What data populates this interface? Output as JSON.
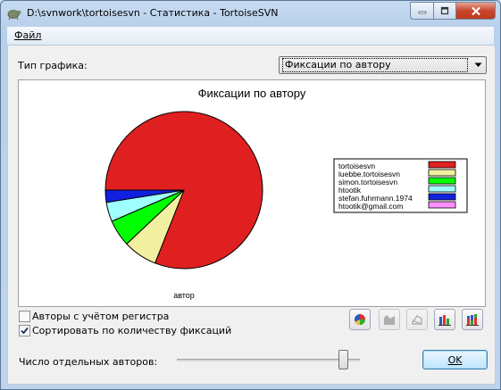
{
  "window": {
    "title": "D:\\svnwork\\tortoisesvn - Статистика - TortoiseSVN"
  },
  "menu": {
    "file": "Файл"
  },
  "graph_type": {
    "label": "Тип графика:",
    "selected": "Фиксации по автору"
  },
  "chart_data": {
    "type": "pie",
    "title": "Фиксации по автору",
    "xlabel": "автор",
    "legend_position": "right",
    "slices": [
      {
        "label": "tortoisesvn",
        "value": 81,
        "color": "#e02020"
      },
      {
        "label": "luebbe.tortoisesvn",
        "value": 7,
        "color": "#f0f0a0"
      },
      {
        "label": "simon.tortoisesvn",
        "value": 5.5,
        "color": "#00ff00"
      },
      {
        "label": "htootik",
        "value": 4,
        "color": "#a0ffff"
      },
      {
        "label": "stefan.fuhrmann.1974",
        "value": 2.5,
        "color": "#1020e0"
      },
      {
        "label": "htootik@gmail.com",
        "value": 0,
        "color": "#ff90ff"
      }
    ]
  },
  "options": {
    "case_sensitive": {
      "label": "Авторы с учётом регистра",
      "checked": false
    },
    "sort_by_commits": {
      "label": "Сортировать по количеству фиксаций",
      "checked": true
    }
  },
  "authors_count": {
    "label": "Число отдельных авторов:",
    "level": 0.9
  },
  "ok_button": "OK"
}
